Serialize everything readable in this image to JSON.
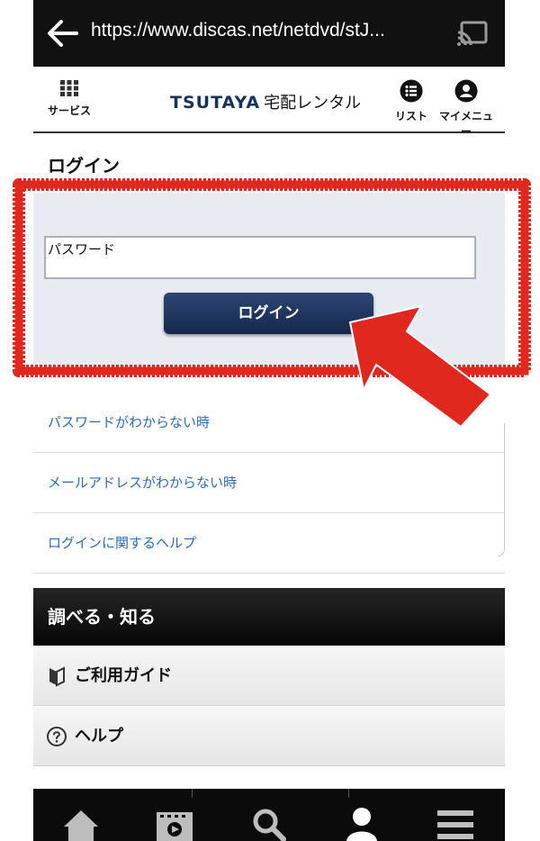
{
  "browser": {
    "url": "https://www.discas.net/netdvd/stJ..."
  },
  "header": {
    "service_label": "サービス",
    "logo_brand": "TSUTAYA",
    "logo_sub": "宅配レンタル",
    "list_label": "リスト",
    "mymenu_label": "マイメニュー"
  },
  "login": {
    "title": "ログイン",
    "password_placeholder": "パスワード",
    "button_label": "ログイン"
  },
  "help_links": [
    {
      "label": "パスワードがわからない時"
    },
    {
      "label": "メールアドレスがわからない時"
    },
    {
      "label": "ログインに関するヘルプ"
    }
  ],
  "section": {
    "title": "調べる・知る",
    "items": [
      {
        "label": "ご利用ガイド",
        "icon": "beginner-mark-icon"
      },
      {
        "label": "ヘルプ",
        "icon": "question-circle-icon"
      }
    ]
  },
  "bottom_nav": {
    "items": [
      {
        "icon": "home-icon"
      },
      {
        "icon": "film-icon"
      },
      {
        "icon": "search-icon"
      },
      {
        "icon": "user-icon"
      },
      {
        "icon": "menu-icon"
      }
    ]
  },
  "colors": {
    "brand_navy": "#16335f",
    "link_blue": "#2a6bbf",
    "annotation_red": "#e0281e",
    "login_panel": "#e8ecf2"
  }
}
